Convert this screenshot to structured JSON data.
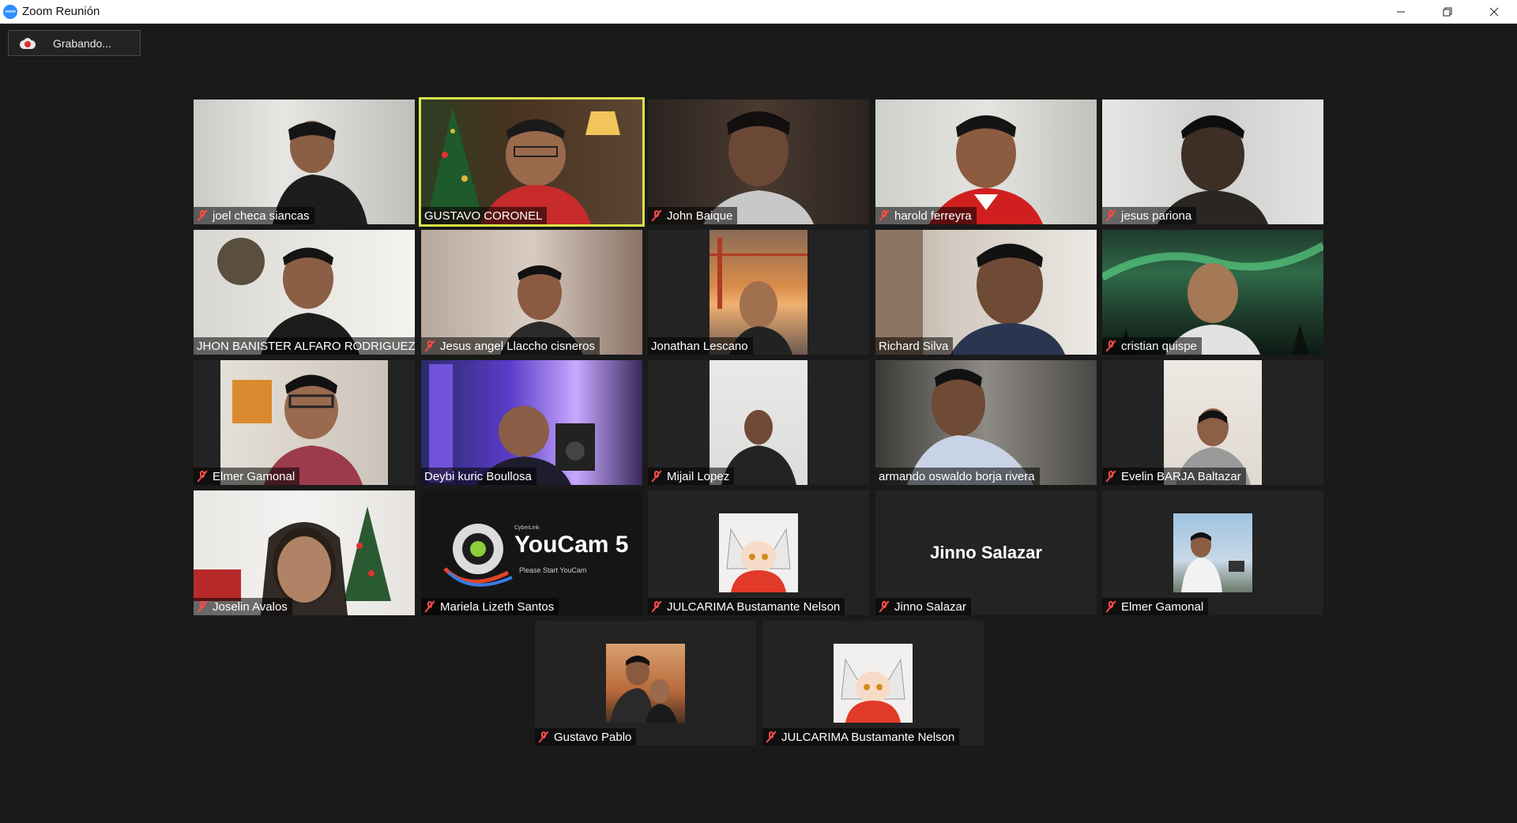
{
  "window": {
    "title": "Zoom Reunión",
    "app_icon": "zoom"
  },
  "recording": {
    "label": "Grabando..."
  },
  "participants": [
    {
      "name": "joel checa siancas",
      "muted": true
    },
    {
      "name": "GUSTAVO CORONEL",
      "muted": false,
      "active_speaker": true
    },
    {
      "name": "John Baique",
      "muted": true
    },
    {
      "name": "harold ferreyra",
      "muted": true
    },
    {
      "name": "jesus pariona",
      "muted": true
    },
    {
      "name": "JHON BANISTER ALFARO RODRIGUEZ",
      "muted": false
    },
    {
      "name": "Jesus angel Llaccho cisneros",
      "muted": true
    },
    {
      "name": "Jonathan Lescano",
      "muted": false
    },
    {
      "name": "Richard Silva",
      "muted": false
    },
    {
      "name": "cristian quispe",
      "muted": true
    },
    {
      "name": "Elmer Gamonal",
      "muted": true
    },
    {
      "name": "Deybi kuric Boullosa",
      "muted": false
    },
    {
      "name": "Mijail Lopez",
      "muted": true
    },
    {
      "name": "armando oswaldo borja rivera",
      "muted": false
    },
    {
      "name": "Evelin BARJA  Baltazar",
      "muted": true
    },
    {
      "name": "Joselin Avalos",
      "muted": true
    },
    {
      "name": "Mariela Lizeth Santos",
      "muted": true,
      "video_text": {
        "brand": "CyberLink",
        "product": "YouCam 5",
        "hint": "Please Start YouCam"
      }
    },
    {
      "name": "JULCARIMA Bustamante Nelson",
      "muted": true
    },
    {
      "name": "Jinno Salazar",
      "muted": true,
      "big_name": "Jinno Salazar"
    },
    {
      "name": "Elmer Gamonal",
      "muted": true
    },
    {
      "name": "Gustavo Pablo",
      "muted": true
    },
    {
      "name": "JULCARIMA Bustamante Nelson",
      "muted": true
    }
  ]
}
